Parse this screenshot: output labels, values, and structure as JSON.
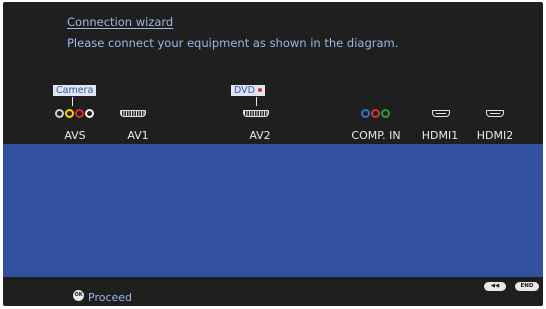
{
  "header": {
    "title": "Connection wizard ",
    "subtitle": "Please connect your equipment as shown in the diagram."
  },
  "devices": {
    "camera": "Camera",
    "dvd": "DVD"
  },
  "ports": [
    "AVS",
    "AV1",
    "AV2",
    "COMP. IN",
    "HDMI1",
    "HDMI2"
  ],
  "connector_colors": {
    "avs": [
      "#ffd400",
      "#d83030",
      "#f2f2f2"
    ],
    "component": [
      "#2f6fd6",
      "#d83030",
      "#2e9a3a"
    ]
  },
  "colors": {
    "background": "#1f1f1f",
    "accent_text": "#9bb8e8",
    "diagram_panel": "#3250a0"
  },
  "footer": {
    "ok_icon": "OK",
    "proceed": "Proceed",
    "rewind_icon": "◀◀",
    "end_icon": "END"
  }
}
